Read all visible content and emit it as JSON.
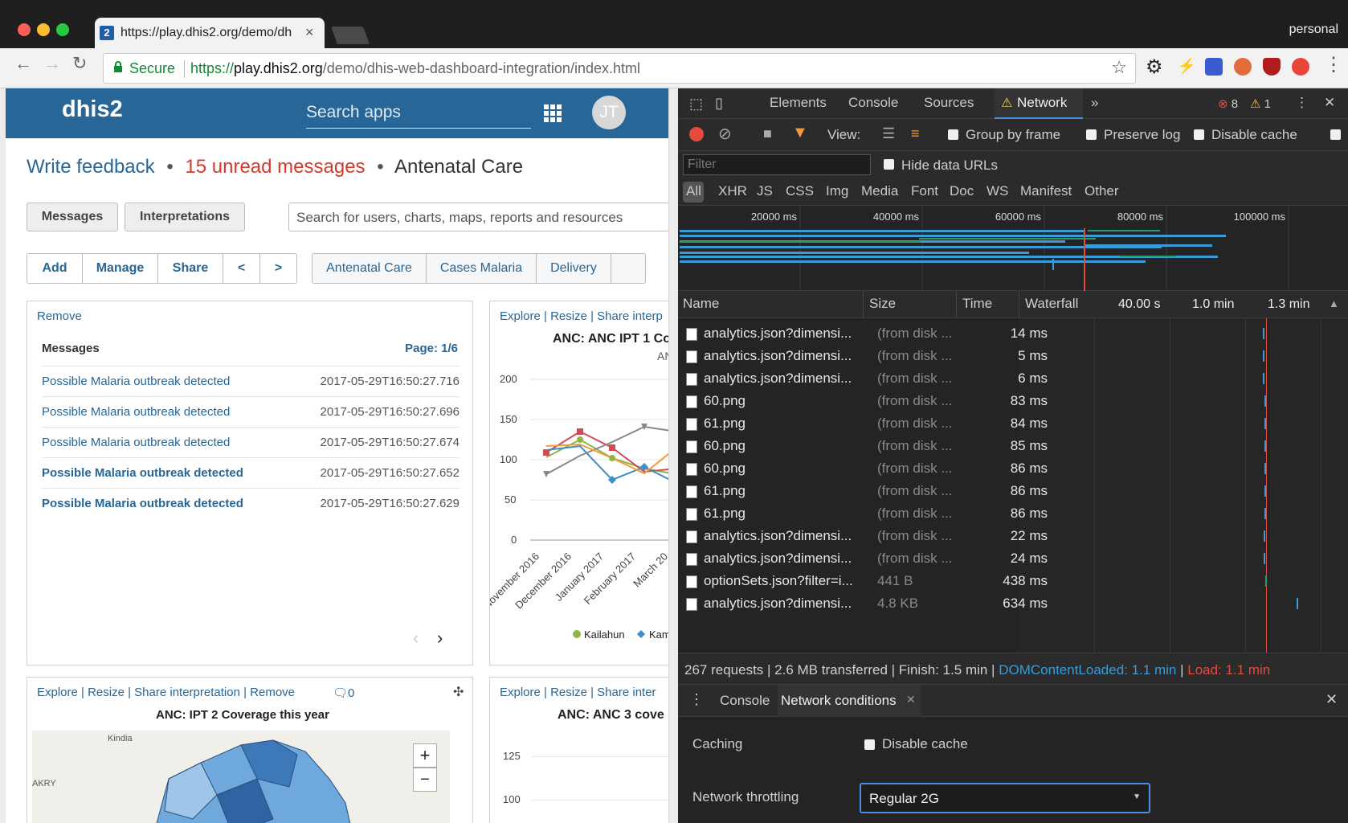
{
  "browser": {
    "tab_title": "https://play.dhis2.org/demo/dh",
    "tab_favicon": "2",
    "profile": "personal",
    "secure_label": "Secure",
    "url_scheme": "https://",
    "url_host": "play.dhis2.org",
    "url_path": "/demo/dhis-web-dashboard-integration/index.html"
  },
  "dhis": {
    "logo": "dhis2",
    "search_placeholder": "Search apps",
    "avatar": "JT",
    "write_feedback": "Write feedback",
    "unread": "15 unread messages",
    "dashboard_title": "Antenatal Care",
    "btn_messages": "Messages",
    "btn_interpretations": "Interpretations",
    "search_resources": "Search for users, charts, maps, reports and resources",
    "btn_add": "Add",
    "btn_manage": "Manage",
    "btn_share": "Share",
    "btn_prev": "<",
    "btn_next": ">",
    "dash_tabs": [
      "Antenatal Care",
      "Cases Malaria",
      "Delivery"
    ],
    "messages_card": {
      "remove": "Remove",
      "title": "Messages",
      "page": "Page: 1/6",
      "rows": [
        {
          "text": "Possible Malaria outbreak detected",
          "date": "2017-05-29T16:50:27.716",
          "bold": false
        },
        {
          "text": "Possible Malaria outbreak detected",
          "date": "2017-05-29T16:50:27.696",
          "bold": false
        },
        {
          "text": "Possible Malaria outbreak detected",
          "date": "2017-05-29T16:50:27.674",
          "bold": false
        },
        {
          "text": "Possible Malaria outbreak detected",
          "date": "2017-05-29T16:50:27.652",
          "bold": true
        },
        {
          "text": "Possible Malaria outbreak detected",
          "date": "2017-05-29T16:50:27.629",
          "bold": true
        }
      ]
    },
    "chart_card": {
      "links": "Explore | Resize | Share interp",
      "title": "ANC: ANC IPT 1 Co",
      "subtitle": "AN",
      "yticks": [
        "200",
        "150",
        "100",
        "50",
        "0"
      ],
      "xticks": [
        "November 2016",
        "December 2016",
        "January 2017",
        "February 2017",
        "March 20"
      ],
      "legend": [
        "Kailahun",
        "Kam"
      ]
    },
    "map_card": {
      "links": "Explore | Resize | Share interpretation | Remove",
      "comments": "0",
      "title": "ANC: IPT 2 Coverage this year",
      "places": [
        "Kindia",
        "AKRY"
      ],
      "zoom_in": "+",
      "zoom_out": "−"
    },
    "chart3_card": {
      "links": "Explore | Resize | Share inter",
      "title": "ANC: ANC 3 cove",
      "yticks": [
        "125",
        "100"
      ]
    }
  },
  "devtools": {
    "tabs": [
      "Elements",
      "Console",
      "Sources",
      "Network"
    ],
    "errors": "8",
    "warnings": "1",
    "view_label": "View:",
    "group_by_frame": "Group by frame",
    "preserve_log": "Preserve log",
    "disable_cache": "Disable cache",
    "filter_placeholder": "Filter",
    "hide_data_urls": "Hide data URLs",
    "types": [
      "All",
      "XHR",
      "JS",
      "CSS",
      "Img",
      "Media",
      "Font",
      "Doc",
      "WS",
      "Manifest",
      "Other"
    ],
    "timeline_ticks": [
      "20000 ms",
      "40000 ms",
      "60000 ms",
      "80000 ms",
      "100000 ms"
    ],
    "columns": {
      "name": "Name",
      "size": "Size",
      "time": "Time",
      "waterfall": "Waterfall",
      "w1": "40.00 s",
      "w2": "1.0 min",
      "w3": "1.3 min"
    },
    "rows": [
      {
        "name": "analytics.json?dimensi...",
        "size": "(from disk ...",
        "time": "14 ms"
      },
      {
        "name": "analytics.json?dimensi...",
        "size": "(from disk ...",
        "time": "5 ms"
      },
      {
        "name": "analytics.json?dimensi...",
        "size": "(from disk ...",
        "time": "6 ms"
      },
      {
        "name": "60.png",
        "size": "(from disk ...",
        "time": "83 ms"
      },
      {
        "name": "61.png",
        "size": "(from disk ...",
        "time": "84 ms"
      },
      {
        "name": "60.png",
        "size": "(from disk ...",
        "time": "85 ms"
      },
      {
        "name": "60.png",
        "size": "(from disk ...",
        "time": "86 ms"
      },
      {
        "name": "61.png",
        "size": "(from disk ...",
        "time": "86 ms"
      },
      {
        "name": "61.png",
        "size": "(from disk ...",
        "time": "86 ms"
      },
      {
        "name": "analytics.json?dimensi...",
        "size": "(from disk ...",
        "time": "22 ms"
      },
      {
        "name": "analytics.json?dimensi...",
        "size": "(from disk ...",
        "time": "24 ms"
      },
      {
        "name": "optionSets.json?filter=i...",
        "size": "441 B",
        "time": "438 ms"
      },
      {
        "name": "analytics.json?dimensi...",
        "size": "4.8 KB",
        "time": "634 ms"
      }
    ],
    "status_main": "267 requests | 2.6 MB transferred | Finish: 1.5 min |",
    "status_dcl": "DOMContentLoaded: 1.1 min",
    "status_sep": "|",
    "status_load": "Load: 1.1 min",
    "drawer_console": "Console",
    "drawer_netcond": "Network conditions",
    "caching_label": "Caching",
    "disable_cache2": "Disable cache",
    "throttling_label": "Network throttling",
    "throttling_value": "Regular 2G"
  },
  "colors": {
    "dhis_blue": "#276696",
    "unread_red": "#d23a2d",
    "dcl_blue": "#3a9bd9",
    "load_red": "#e34c3c"
  }
}
